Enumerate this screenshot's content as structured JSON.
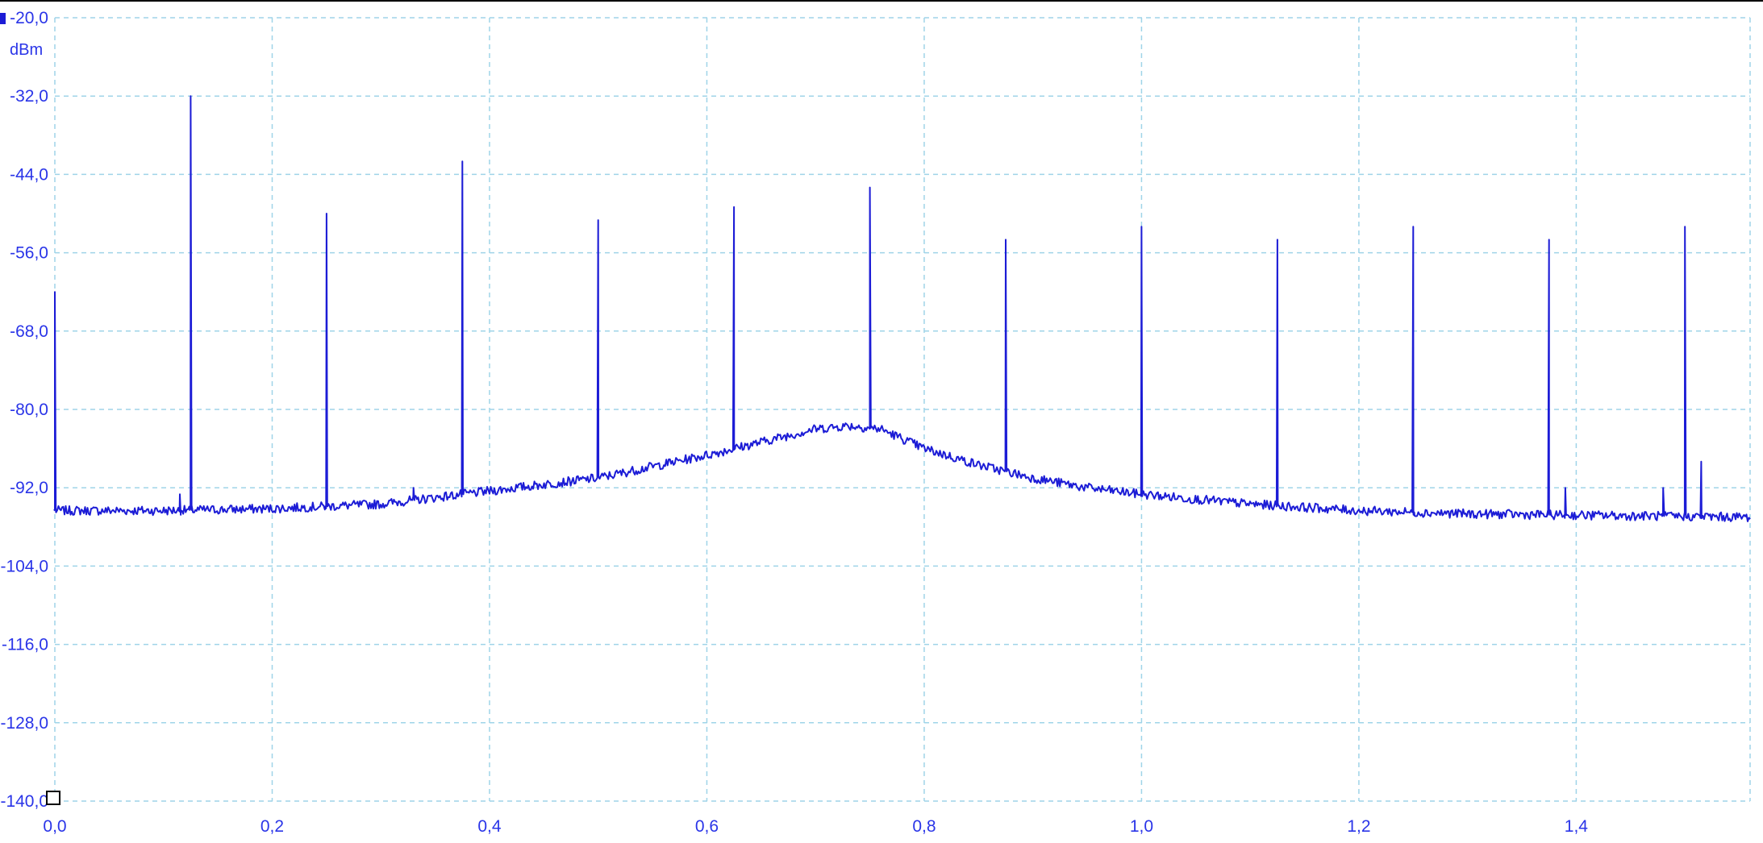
{
  "chart_data": {
    "type": "line",
    "ylabel": "dBm",
    "xlim": [
      0.0,
      1.56
    ],
    "ylim": [
      -140.0,
      -20.0
    ],
    "grid": true,
    "line_color": "#1c1cd6",
    "grid_color": "#9fd4e8",
    "axis_text_color": "#2a35e8",
    "y_ticks": [
      {
        "value": -20,
        "label": "-20,0"
      },
      {
        "value": -32,
        "label": "-32,0"
      },
      {
        "value": -44,
        "label": "-44,0"
      },
      {
        "value": -56,
        "label": "-56,0"
      },
      {
        "value": -68,
        "label": "-68,0"
      },
      {
        "value": -80,
        "label": "-80,0"
      },
      {
        "value": -92,
        "label": "-92,0"
      },
      {
        "value": -104,
        "label": "-104,0"
      },
      {
        "value": -116,
        "label": "-116,0"
      },
      {
        "value": -128,
        "label": "-128,0"
      },
      {
        "value": -140,
        "label": "-140,0"
      }
    ],
    "x_ticks": [
      {
        "value": 0.0,
        "label": "0,0"
      },
      {
        "value": 0.2,
        "label": "0,2"
      },
      {
        "value": 0.4,
        "label": "0,4"
      },
      {
        "value": 0.6,
        "label": "0,6"
      },
      {
        "value": 0.8,
        "label": "0,8"
      },
      {
        "value": 1.0,
        "label": "1,0"
      },
      {
        "value": 1.2,
        "label": "1,2"
      },
      {
        "value": 1.4,
        "label": "1,4"
      }
    ],
    "x_grid_extra": [
      1.56
    ],
    "series": [
      {
        "noise_floor": [
          [
            0.0,
            -95.5
          ],
          [
            0.1,
            -95.5
          ],
          [
            0.2,
            -95.2
          ],
          [
            0.3,
            -94.5
          ],
          [
            0.4,
            -92.5
          ],
          [
            0.5,
            -90.5
          ],
          [
            0.6,
            -87.0
          ],
          [
            0.65,
            -85.0
          ],
          [
            0.7,
            -83.0
          ],
          [
            0.73,
            -82.5
          ],
          [
            0.76,
            -83.0
          ],
          [
            0.8,
            -86.0
          ],
          [
            0.85,
            -88.5
          ],
          [
            0.9,
            -90.5
          ],
          [
            0.95,
            -92.0
          ],
          [
            1.0,
            -93.0
          ],
          [
            1.1,
            -94.5
          ],
          [
            1.2,
            -95.5
          ],
          [
            1.3,
            -96.0
          ],
          [
            1.4,
            -96.2
          ],
          [
            1.56,
            -96.5
          ]
        ],
        "peaks": [
          {
            "x": 0.0,
            "y": -62.0
          },
          {
            "x": 0.115,
            "y": -93.0
          },
          {
            "x": 0.125,
            "y": -32.0
          },
          {
            "x": 0.25,
            "y": -50.0
          },
          {
            "x": 0.33,
            "y": -92.0
          },
          {
            "x": 0.375,
            "y": -42.0
          },
          {
            "x": 0.5,
            "y": -51.0
          },
          {
            "x": 0.625,
            "y": -49.0
          },
          {
            "x": 0.75,
            "y": -46.0
          },
          {
            "x": 0.875,
            "y": -54.0
          },
          {
            "x": 1.0,
            "y": -52.0
          },
          {
            "x": 1.125,
            "y": -54.0
          },
          {
            "x": 1.25,
            "y": -52.0
          },
          {
            "x": 1.375,
            "y": -54.0
          },
          {
            "x": 1.39,
            "y": -92.0
          },
          {
            "x": 1.48,
            "y": -92.0
          },
          {
            "x": 1.5,
            "y": -52.0
          },
          {
            "x": 1.515,
            "y": -88.0
          }
        ]
      }
    ]
  }
}
